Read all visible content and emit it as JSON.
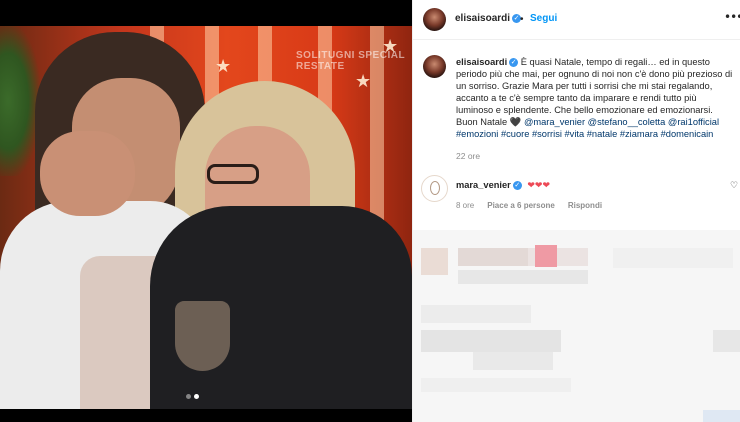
{
  "media": {
    "watermark": "SOLITUGNI SPECIAL\nRESTATE",
    "carousel_dots": 2,
    "active_dot": 1
  },
  "header": {
    "username": "elisaisoardi",
    "verified_glyph": "✓",
    "separator": "•",
    "follow_label": "Segui",
    "more_glyph": "•••"
  },
  "caption": {
    "username": "elisaisoardi",
    "verified_glyph": "✓",
    "text_1": "È quasi Natale, tempo di regali… ed in questo periodo più che mai, per ognuno di noi non c'è dono più prezioso di un sorriso. Grazie Mara per tutti i sorrisi che mi stai regalando, accanto a te c'è sempre tanto da imparare e rendi tutto più luminoso e splendente. Che bello emozionare ed emozionarsi.",
    "text_2": "Buon Natale",
    "heart_glyph": "🖤",
    "mentions": "@mara_venier @stefano__coletta @rai1official",
    "hashtags": "#emozioni #cuore #sorrisi #vita #natale #ziamara #domenicain",
    "time": "22 ore"
  },
  "comment": {
    "username": "mara_venier",
    "verified_glyph": "✓",
    "text": "❤❤❤",
    "time": "8 ore",
    "likes": "Piace a 6 persone",
    "reply_label": "Rispondi",
    "like_icon_glyph": "♡"
  },
  "colors": {
    "link_blue": "#0095f6",
    "tag_blue": "#00376b",
    "heart_red": "#ed4956",
    "muted": "#8e8e8e"
  }
}
